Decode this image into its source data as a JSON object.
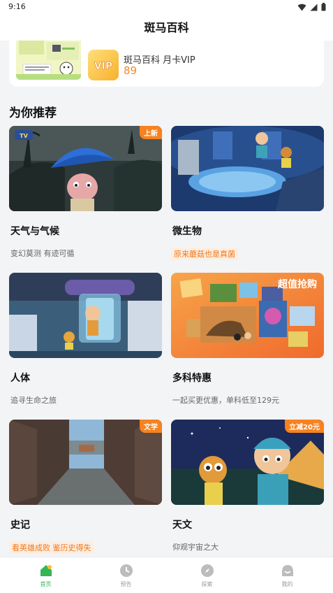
{
  "status": {
    "time": "9:16"
  },
  "header": {
    "title": "斑马百科"
  },
  "promo": {
    "title": "斑马百科 月卡VIP",
    "price": "89"
  },
  "section": {
    "title": "为你推荐"
  },
  "cards": [
    {
      "title": "天气与气候",
      "subtitle": "变幻莫测 有迹可循",
      "badge": "上新",
      "tv_label": "TV"
    },
    {
      "title": "微生物",
      "subtitle": "原来蘑菇也是真菌"
    },
    {
      "title": "人体",
      "subtitle": "追寻生命之旅"
    },
    {
      "title": "多科特惠",
      "subtitle": "一起买更优惠，单科低至129元",
      "badge": "超值抢购"
    },
    {
      "title": "史记",
      "subtitle": "看英雄成败 鉴历史得失",
      "badge": "文学"
    },
    {
      "title": "天文",
      "subtitle": "仰观宇宙之大",
      "badge": "立减20元"
    }
  ],
  "nav": [
    {
      "label": "首页",
      "icon": "home-icon",
      "active": true
    },
    {
      "label": "预告",
      "icon": "clock-icon"
    },
    {
      "label": "探索",
      "icon": "compass-icon"
    },
    {
      "label": "我的",
      "icon": "profile-icon"
    }
  ],
  "colors": {
    "accent": "#f7821f",
    "nav_active": "#35b654",
    "price": "#f08a24"
  }
}
